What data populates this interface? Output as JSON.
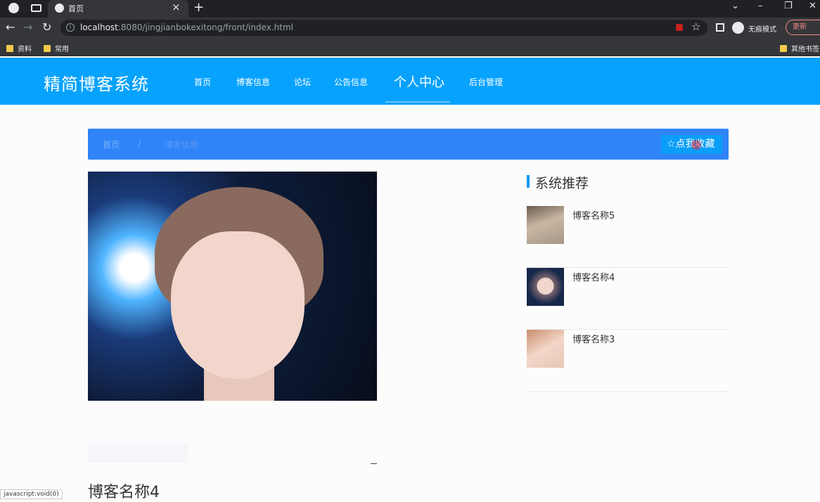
{
  "browser": {
    "tab_title": "首页",
    "url_host": "localhost",
    "url_rest": ":8080/jingjianbokexitong/front/index.html",
    "incognito_label": "无痕模式",
    "update_label": "更新",
    "bookmarks": [
      "资料",
      "常用",
      "其他书签"
    ],
    "status_text": "javascript:void(0)"
  },
  "site": {
    "logo": "精简博客系统",
    "nav": [
      "首页",
      "博客信息",
      "论坛",
      "公告信息",
      "个人中心",
      "后台管理"
    ],
    "accent_color": "#06a2fd"
  },
  "breadcrumb": {
    "home": "首页",
    "separator": "/",
    "current": "博客信息",
    "favorite_button": "☆点我收藏"
  },
  "detail": {
    "title": "博客名称4"
  },
  "recommend": {
    "title": "系统推荐",
    "items": [
      {
        "name": "博客名称5"
      },
      {
        "name": "博客名称4"
      },
      {
        "name": "博客名称3"
      }
    ]
  }
}
